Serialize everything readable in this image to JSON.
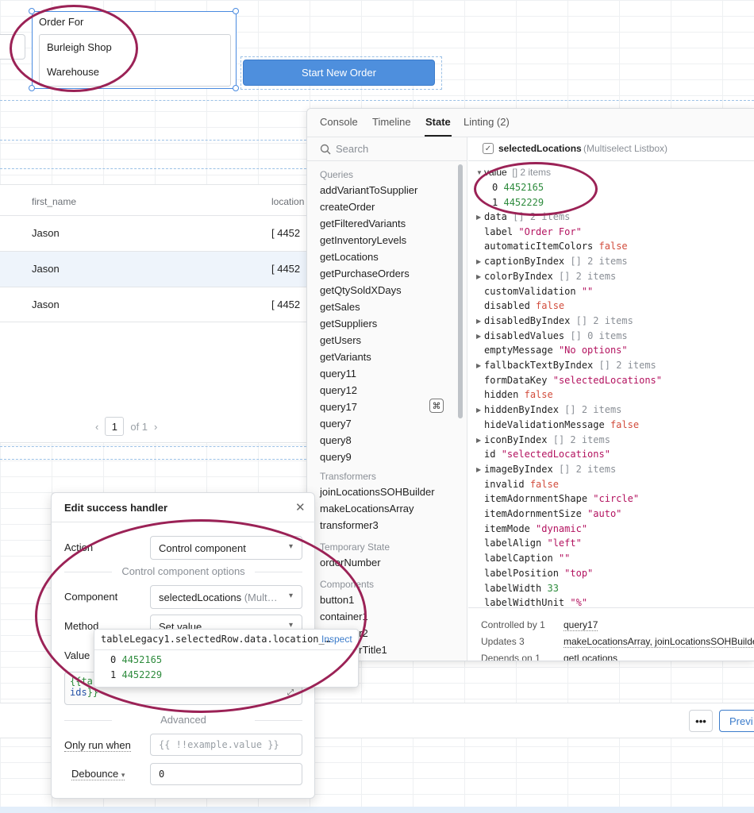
{
  "listbox": {
    "label": "Order For",
    "options": [
      "Burleigh Shop",
      "Warehouse"
    ]
  },
  "start_button": {
    "label": "Start New Order"
  },
  "table": {
    "columns": [
      "first_name",
      "location"
    ],
    "rows": [
      {
        "first_name": "Jason",
        "location": "[ 4452"
      },
      {
        "first_name": "Jason",
        "location": "[ 4452"
      },
      {
        "first_name": "Jason",
        "location": "[ 4452"
      }
    ],
    "pagination": {
      "page": "1",
      "of_text": "of 1",
      "prev": "‹",
      "next": "›"
    }
  },
  "debug_panel": {
    "tabs": [
      "Console",
      "Timeline",
      "State",
      "Linting (2)"
    ],
    "active_tab": "State",
    "search_placeholder": "Search",
    "sections": {
      "queries": {
        "title": "Queries",
        "items": [
          "addVariantToSupplier",
          "createOrder",
          "getFilteredVariants",
          "getInventoryLevels",
          "getLocations",
          "getPurchaseOrders",
          "getQtySoldXDays",
          "getSales",
          "getSuppliers",
          "getUsers",
          "getVariants",
          "query11",
          "query12",
          "query17",
          "query7",
          "query8",
          "query9"
        ]
      },
      "transformers": {
        "title": "Transformers",
        "items": [
          "joinLocationsSOHBuilder",
          "makeLocationsArray",
          "transformer3"
        ]
      },
      "temporary_state": {
        "title": "Temporary State",
        "items": [
          "orderNumber"
        ]
      },
      "components": {
        "title": "Components",
        "items": [
          "button1",
          "container1",
          "container2",
          "containerTitle1"
        ]
      }
    },
    "inspector": {
      "name": "selectedLocations",
      "type": "(Multiselect Listbox)",
      "properties": [
        {
          "key": "value",
          "type": "array",
          "count": "[]  2 items",
          "expanded": true,
          "children": [
            {
              "idx": "0",
              "val": "4452165"
            },
            {
              "idx": "1",
              "val": "4452229"
            }
          ]
        },
        {
          "key": "data",
          "type": "array",
          "count": "[]  2 items"
        },
        {
          "key": "label",
          "type": "string",
          "val": "\"Order For\""
        },
        {
          "key": "automaticItemColors",
          "type": "bool",
          "val": "false"
        },
        {
          "key": "captionByIndex",
          "type": "array",
          "count": "[]  2 items"
        },
        {
          "key": "colorByIndex",
          "type": "array",
          "count": "[]  2 items"
        },
        {
          "key": "customValidation",
          "type": "string",
          "val": "\"\""
        },
        {
          "key": "disabled",
          "type": "bool",
          "val": "false"
        },
        {
          "key": "disabledByIndex",
          "type": "array",
          "count": "[]  2 items"
        },
        {
          "key": "disabledValues",
          "type": "array",
          "count": "[]  0 items"
        },
        {
          "key": "emptyMessage",
          "type": "string",
          "val": "\"No options\""
        },
        {
          "key": "fallbackTextByIndex",
          "type": "array",
          "count": "[]  2 items"
        },
        {
          "key": "formDataKey",
          "type": "string",
          "val": "\"selectedLocations\""
        },
        {
          "key": "hidden",
          "type": "bool",
          "val": "false"
        },
        {
          "key": "hiddenByIndex",
          "type": "array",
          "count": "[]  2 items"
        },
        {
          "key": "hideValidationMessage",
          "type": "bool",
          "val": "false"
        },
        {
          "key": "iconByIndex",
          "type": "array",
          "count": "[]  2 items"
        },
        {
          "key": "id",
          "type": "string",
          "val": "\"selectedLocations\""
        },
        {
          "key": "imageByIndex",
          "type": "array",
          "count": "[]  2 items"
        },
        {
          "key": "invalid",
          "type": "bool",
          "val": "false"
        },
        {
          "key": "itemAdornmentShape",
          "type": "string",
          "val": "\"circle\""
        },
        {
          "key": "itemAdornmentSize",
          "type": "string",
          "val": "\"auto\""
        },
        {
          "key": "itemMode",
          "type": "string",
          "val": "\"dynamic\""
        },
        {
          "key": "labelAlign",
          "type": "string",
          "val": "\"left\""
        },
        {
          "key": "labelCaption",
          "type": "string",
          "val": "\"\""
        },
        {
          "key": "labelPosition",
          "type": "string",
          "val": "\"top\""
        },
        {
          "key": "labelWidth",
          "type": "number",
          "val": "33"
        },
        {
          "key": "labelWidthUnit",
          "type": "string",
          "val": "\"%\""
        }
      ],
      "dependencies": [
        {
          "label": "Controlled by",
          "count": "1",
          "value": "query17"
        },
        {
          "label": "Updates",
          "count": "3",
          "value": "makeLocationsArray, joinLocationsSOHBuilder"
        },
        {
          "label": "Depends on",
          "count": "1",
          "value": "getLocations"
        }
      ]
    }
  },
  "handler_dialog": {
    "title": "Edit success handler",
    "action_label": "Action",
    "action_value": "Control component",
    "options_divider": "Control component options",
    "component_label": "Component",
    "component_value": "selectedLocations",
    "component_type": "(Mult…",
    "method_label": "Method",
    "method_value": "Set value",
    "value_label": "Value",
    "value_code_line1": "{{ta",
    "value_code_line2_id": "ids",
    "value_code_line2_br": "}}",
    "advanced_divider": "Advanced",
    "only_run_label": "Only run when",
    "only_run_placeholder": "{{ !!example.value }}",
    "debounce_label": "Debounce",
    "debounce_value": "0"
  },
  "value_popup": {
    "path": "tableLegacy1.selectedRow.data.location_…",
    "inspect_label": "Inspect",
    "items": [
      {
        "idx": "0",
        "val": "4452165"
      },
      {
        "idx": "1",
        "val": "4452229"
      }
    ]
  },
  "bottom_toolbar": {
    "more_label": "•••",
    "preview_label": "Previ"
  },
  "annotation_color": "#9b2256"
}
